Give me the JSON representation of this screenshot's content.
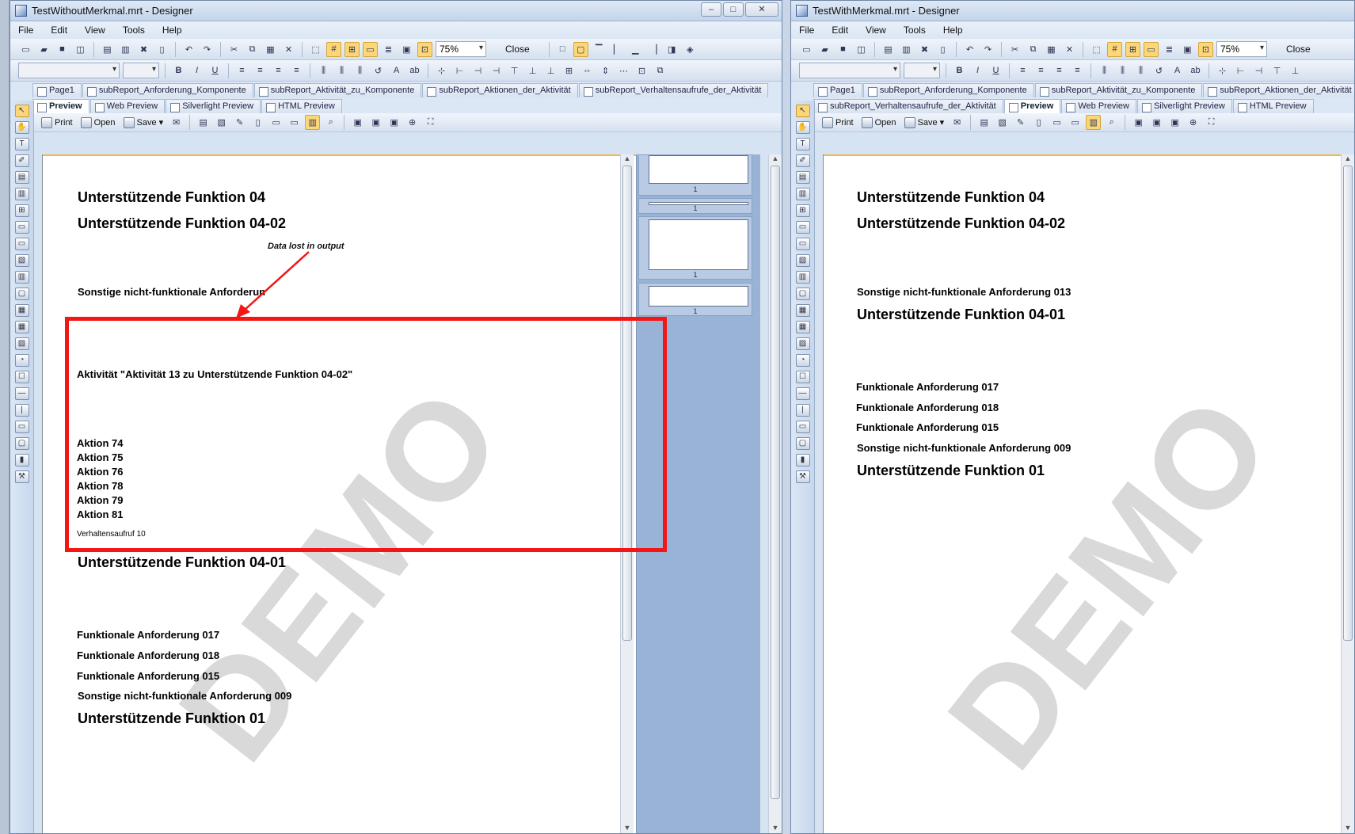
{
  "left_window": {
    "title": "TestWithoutMerkmal.mrt - Designer",
    "menu": [
      "File",
      "Edit",
      "View",
      "Tools",
      "Help"
    ],
    "zoom": "75%",
    "close_label": "Close",
    "tabs": [
      "Page1",
      "subReport_Anforderung_Komponente",
      "subReport_Aktivität_zu_Komponente",
      "subReport_Aktionen_der_Aktivität",
      "subReport_Verhaltensaufrufe_der_Aktivität"
    ],
    "preview_tabs": [
      "Preview",
      "Web Preview",
      "Silverlight Preview",
      "HTML Preview"
    ],
    "preview_toolbar": {
      "print": "Print",
      "open": "Open",
      "save": "Save"
    },
    "report": {
      "line1": "Unterstützende Funktion 04",
      "line2": "Unterstützende Funktion 04-02",
      "annotation": "Data lost in output",
      "line3": "Sonstige nicht-funktionale Anforderun",
      "aktivitaet": "Aktivität \"Aktivität 13 zu Unterstützende Funktion 04-02\"",
      "aktionen": [
        "Aktion 74",
        "Aktion 75",
        "Aktion 76",
        "Aktion 78",
        "Aktion 79",
        "Aktion 81"
      ],
      "verhaltensaufruf": "Verhaltensaufruf 10",
      "line4": "Unterstützende Funktion 04-01",
      "fa1": "Funktionale Anforderung 017",
      "fa2": "Funktionale Anforderung 018",
      "fa3": "Funktionale Anforderung 015",
      "snfa": "Sonstige nicht-funktionale Anforderung 009",
      "line5": "Unterstützende Funktion 01"
    },
    "watermark": "DEMO",
    "thumb_numbers": [
      "1",
      "1",
      "1",
      "1"
    ]
  },
  "right_window": {
    "title": "TestWithMerkmal.mrt - Designer",
    "menu": [
      "File",
      "Edit",
      "View",
      "Tools",
      "Help"
    ],
    "zoom": "75%",
    "close_label": "Close",
    "tabs_row1": [
      "Page1",
      "subReport_Anforderung_Komponente",
      "subReport_Aktivität_zu_Komponente",
      "subReport_Aktionen_der_Aktivität"
    ],
    "tabs_row2": [
      "subReport_Verhaltensaufrufe_der_Aktivität",
      "Preview",
      "Web Preview",
      "Silverlight Preview",
      "HTML Preview"
    ],
    "preview_toolbar": {
      "print": "Print",
      "open": "Open",
      "save": "Save"
    },
    "report": {
      "line1": "Unterstützende Funktion 04",
      "line2": "Unterstützende Funktion 04-02",
      "line3": "Sonstige nicht-funktionale Anforderung 013",
      "line4": "Unterstützende Funktion 04-01",
      "fa1": "Funktionale Anforderung 017",
      "fa2": "Funktionale Anforderung 018",
      "fa3": "Funktionale Anforderung 015",
      "snfa": "Sonstige nicht-funktionale Anforderung 009",
      "line5": "Unterstützende Funktion 01"
    },
    "watermark": "DEMO"
  },
  "colors": {
    "highlight_box": "#f41515",
    "watermark": "#d9d9d9",
    "accent": "#fbd77a"
  }
}
